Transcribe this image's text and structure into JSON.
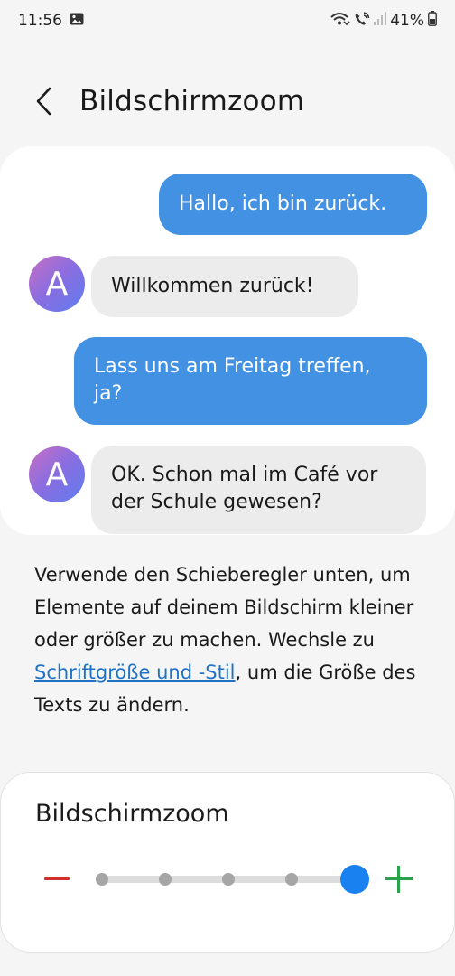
{
  "status_bar": {
    "time": "11:56",
    "battery": "41%",
    "icons": [
      "gallery-icon",
      "wifi-call-icon",
      "volte-call-icon",
      "signal-icon",
      "battery-icon"
    ]
  },
  "header": {
    "back_icon": "back-arrow-icon",
    "title": "Bildschirmzoom"
  },
  "preview": {
    "messages": [
      {
        "direction": "out",
        "text": "Hallo, ich bin zurück."
      },
      {
        "direction": "in",
        "avatar": "A",
        "text": "Willkommen zurück!"
      },
      {
        "direction": "out",
        "text_lines": [
          "Lass uns am Freitag treffen,",
          "ja?"
        ]
      },
      {
        "direction": "in",
        "avatar": "A",
        "text_lines": [
          "OK. Schon mal im Café vor",
          "der Schule gewesen?"
        ]
      }
    ],
    "colors": {
      "outgoing_bubble": "#4391e2",
      "incoming_bubble": "#ececec"
    }
  },
  "description": {
    "before_link": "Verwende den Schieberegler unten, um Elemente auf deinem Bildschirm kleiner oder größer zu machen. Wechsle zu ",
    "link": "Schriftgröße und -Stil",
    "after_link": ", um die Größe des Texts zu ändern."
  },
  "zoom": {
    "title": "Bildschirmzoom",
    "levels": 5,
    "selected_level": 5,
    "minus_icon": "minus-icon",
    "plus_icon": "plus-icon",
    "colors": {
      "minus": "#d0312d",
      "plus": "#2aa24a",
      "thumb": "#1a82f0"
    }
  }
}
